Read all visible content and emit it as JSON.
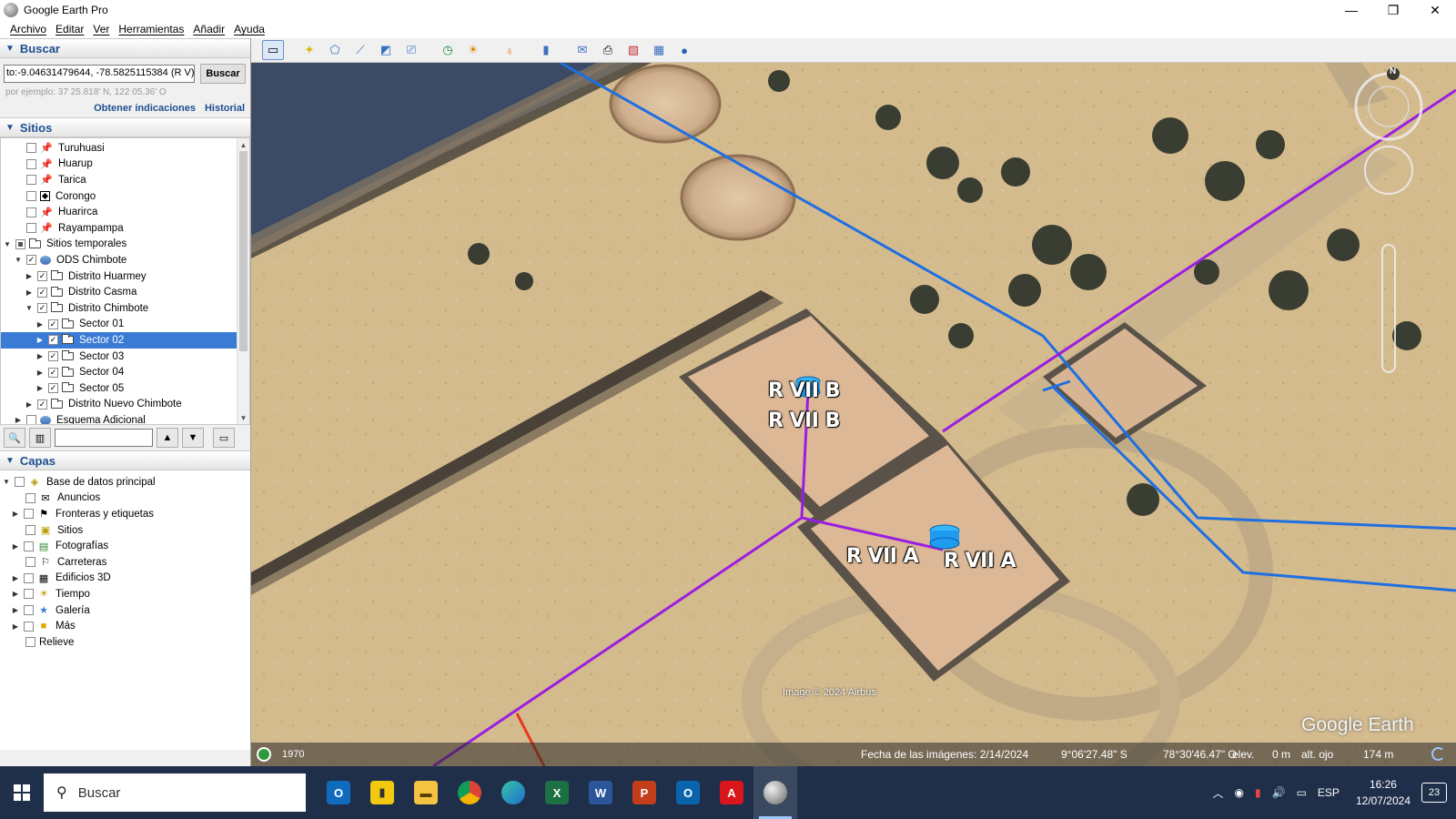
{
  "window": {
    "title": "Google Earth Pro",
    "minimize": "—",
    "maximize": "❐",
    "close": "✕"
  },
  "menu": [
    "Archivo",
    "Editar",
    "Ver",
    "Herramientas",
    "Añadir",
    "Ayuda"
  ],
  "search": {
    "header": "Buscar",
    "value": "to:-9.04631479644, -78.5825115384 (R V)",
    "button": "Buscar",
    "hint": "por ejemplo: 37 25.818' N, 122 05.36' O",
    "link_directions": "Obtener indicaciones",
    "link_history": "Historial"
  },
  "places": {
    "header": "Sitios",
    "items": [
      {
        "label": "Turuhuasi",
        "icon": "yellow-pushpin-icon"
      },
      {
        "label": "Huarup",
        "icon": "yellow-pushpin-icon"
      },
      {
        "label": "Tarica",
        "icon": "yellow-pushpin-icon"
      },
      {
        "label": "Corongo",
        "icon": "diamond-placemark-icon"
      },
      {
        "label": "Huarirca",
        "icon": "yellow-pushpin-icon"
      },
      {
        "label": "Rayampampa",
        "icon": "yellow-pushpin-icon"
      },
      {
        "label": "Sitios temporales",
        "icon": "folder-icon"
      },
      {
        "label": "ODS Chimbote",
        "icon": "kml-globe-icon"
      },
      {
        "label": "Distrito Huarmey",
        "icon": "folder-icon"
      },
      {
        "label": "Distrito Casma",
        "icon": "folder-icon"
      },
      {
        "label": "Distrito Chimbote",
        "icon": "open-folder-icon"
      },
      {
        "label": "Sector 01",
        "icon": "folder-icon"
      },
      {
        "label": "Sector 02",
        "icon": "folder-icon"
      },
      {
        "label": "Sector 03",
        "icon": "folder-icon"
      },
      {
        "label": "Sector 04",
        "icon": "folder-icon"
      },
      {
        "label": "Sector 05",
        "icon": "folder-icon"
      },
      {
        "label": "Distrito Nuevo Chimbote",
        "icon": "folder-icon"
      },
      {
        "label": "Esquema Adicional",
        "icon": "kml-globe-icon"
      }
    ]
  },
  "layers": {
    "header": "Capas",
    "items": [
      {
        "label": "Base de datos principal",
        "icon": "layers-stack-icon"
      },
      {
        "label": "Anuncios",
        "icon": "envelope-icon"
      },
      {
        "label": "Fronteras y etiquetas",
        "icon": "flag-icon"
      },
      {
        "label": "Sitios",
        "icon": "places-square-icon"
      },
      {
        "label": "Fotografías",
        "icon": "photo-icon"
      },
      {
        "label": "Carreteras",
        "icon": "road-sign-icon"
      },
      {
        "label": "Edificios 3D",
        "icon": "buildings-icon"
      },
      {
        "label": "Tiempo",
        "icon": "sun-icon"
      },
      {
        "label": "Galería",
        "icon": "star-icon"
      },
      {
        "label": "Más",
        "icon": "square-folder-icon"
      },
      {
        "label": "Relieve",
        "icon": ""
      }
    ]
  },
  "map": {
    "labels": [
      "R VII B",
      "R VII B",
      "R VII A",
      "R VII A"
    ],
    "copyright": "Image © 2024 Airbus",
    "logo": "Google Earth",
    "compass_north": "N"
  },
  "status": {
    "year": "1970",
    "date": "Fecha de las imágenes: 2/14/2024",
    "lat": "9°06'27.48\" S",
    "lon": "78°30'46.47\" O",
    "elev_label": "elev.",
    "elev_value": "0 m",
    "eye_label": "alt. ojo",
    "eye_value": "174 m"
  },
  "taskbar": {
    "search_placeholder": "Buscar",
    "time": "16:26",
    "date": "12/07/2024",
    "lang": "ESP",
    "notifications": "23",
    "apps": [
      "outlook-new-icon",
      "power-bi-icon",
      "file-explorer-icon",
      "chrome-icon",
      "edge-icon",
      "excel-icon",
      "word-icon",
      "powerpoint-icon",
      "outlook-icon",
      "acrobat-icon",
      "google-earth-icon"
    ]
  },
  "colors": {
    "blue_line": "#1f6fe0",
    "purple_line": "#9b1ee0",
    "red_line": "#e63a1e",
    "selection": "#3a7bd5"
  }
}
